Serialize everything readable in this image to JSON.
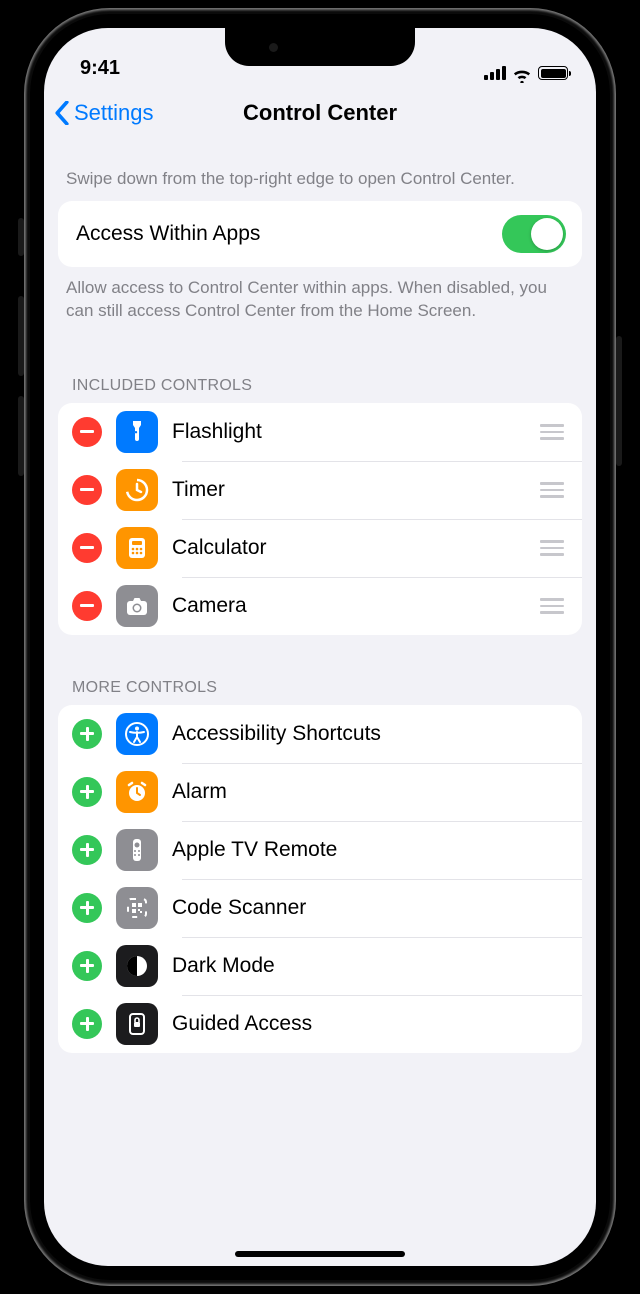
{
  "status": {
    "time": "9:41"
  },
  "nav": {
    "back_label": "Settings",
    "title": "Control Center"
  },
  "hint": "Swipe down from the top-right edge to open Control Center.",
  "access": {
    "label": "Access Within Apps",
    "footer": "Allow access to Control Center within apps. When disabled, you can still access Control Center from the Home Screen.",
    "enabled": true
  },
  "sections": {
    "included_header": "INCLUDED CONTROLS",
    "more_header": "MORE CONTROLS"
  },
  "included": [
    {
      "label": "Flashlight",
      "icon": "flashlight",
      "color": "blue"
    },
    {
      "label": "Timer",
      "icon": "timer",
      "color": "orange"
    },
    {
      "label": "Calculator",
      "icon": "calculator",
      "color": "orange"
    },
    {
      "label": "Camera",
      "icon": "camera",
      "color": "gray"
    }
  ],
  "more": [
    {
      "label": "Accessibility Shortcuts",
      "icon": "accessibility",
      "color": "blue"
    },
    {
      "label": "Alarm",
      "icon": "alarm",
      "color": "orange"
    },
    {
      "label": "Apple TV Remote",
      "icon": "remote",
      "color": "gray"
    },
    {
      "label": "Code Scanner",
      "icon": "qr",
      "color": "gray"
    },
    {
      "label": "Dark Mode",
      "icon": "darkmode",
      "color": "dark"
    },
    {
      "label": "Guided Access",
      "icon": "guided",
      "color": "dark"
    }
  ]
}
